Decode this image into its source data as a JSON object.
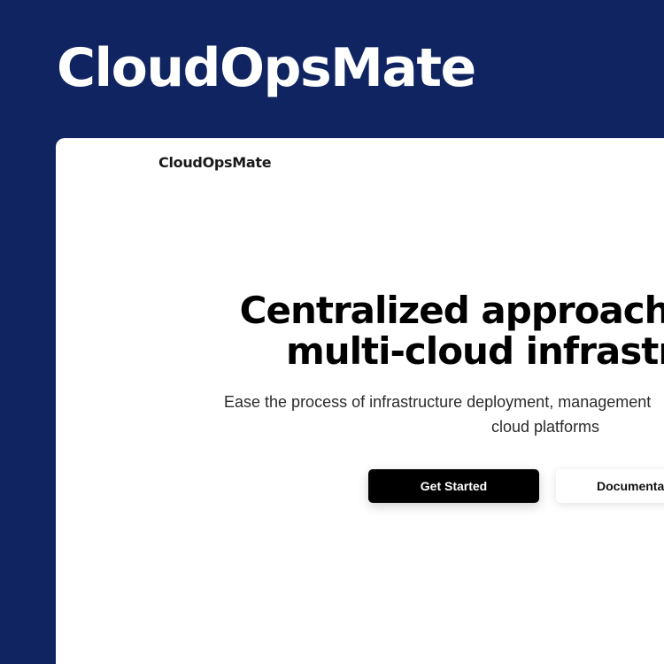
{
  "hero": {
    "brand": "CloudOpsMate"
  },
  "site": {
    "logo": "CloudOpsMate",
    "headline_line1": "Centralized approach fo",
    "headline_line2": "multi-cloud infrastr",
    "subheadline_line1": "Ease the process of infrastructure deployment, management",
    "subheadline_line2": "cloud platforms",
    "primary_cta": "Get Started",
    "secondary_cta": "Documenta"
  },
  "colors": {
    "background": "#0f2461",
    "card": "#ffffff",
    "primary_button": "#000000"
  }
}
